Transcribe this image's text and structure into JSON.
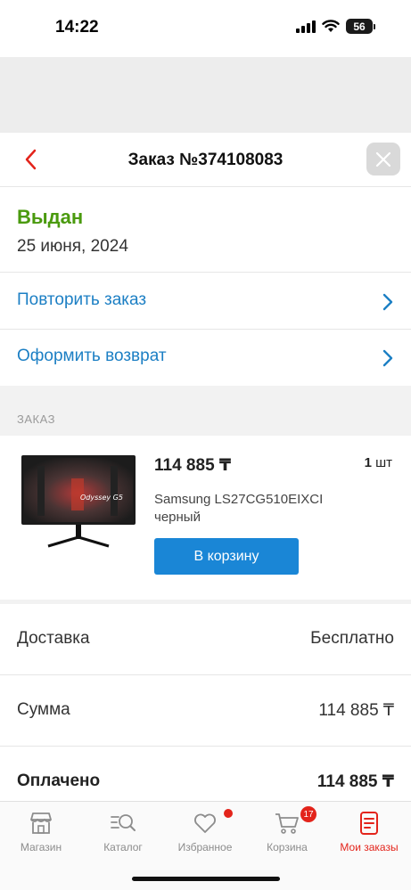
{
  "status_bar": {
    "time": "14:22",
    "battery": "56"
  },
  "header": {
    "title": "Заказ №374108083"
  },
  "order": {
    "status": "Выдан",
    "date": "25 июня, 2024",
    "status_color": "#4a9a0e"
  },
  "actions": [
    {
      "label": "Повторить заказ"
    },
    {
      "label": "Оформить возврат"
    }
  ],
  "section": {
    "label": "ЗАКАЗ"
  },
  "product": {
    "price": "114 885 ₸",
    "qty_number": "1",
    "qty_unit": "шт",
    "name": "Samsung LS27CG510EIXCI черный",
    "cart_button": "В корзину",
    "image_text": "Odyssey G5"
  },
  "summary": [
    {
      "label": "Доставка",
      "value": "Бесплатно"
    },
    {
      "label": "Сумма",
      "value": "114 885 ₸"
    },
    {
      "label": "Оплачено",
      "value": "114 885 ₸"
    }
  ],
  "tabs": [
    {
      "label": "Магазин",
      "icon": "store-icon"
    },
    {
      "label": "Каталог",
      "icon": "catalog-search-icon"
    },
    {
      "label": "Избранное",
      "icon": "heart-icon"
    },
    {
      "label": "Корзина",
      "icon": "cart-icon",
      "badge": "17"
    },
    {
      "label": "Мои заказы",
      "icon": "orders-icon",
      "active": true
    }
  ],
  "colors": {
    "accent_blue": "#1a86d6",
    "link_blue": "#1c7fc4",
    "accent_red": "#e3241b"
  }
}
